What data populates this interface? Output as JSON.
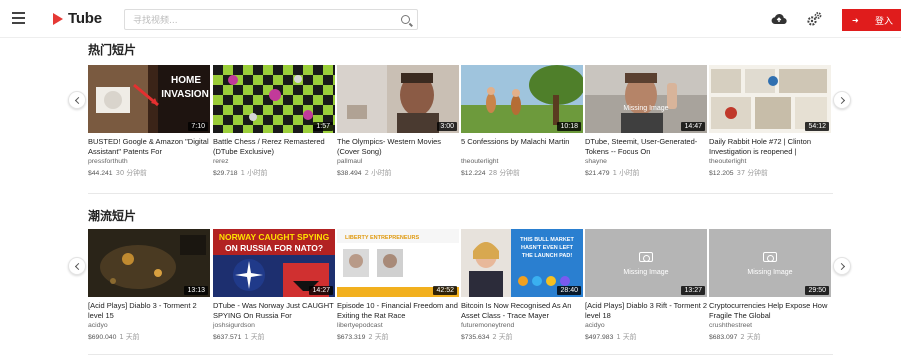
{
  "brand": {
    "name": "Tube"
  },
  "search": {
    "placeholder": "寻找视频..."
  },
  "header": {
    "login_label": "登入"
  },
  "sections": [
    {
      "title": "热门短片",
      "videos": [
        {
          "title": "BUSTED! Google & Amazon \"Digital Assistant\" Patents For",
          "author": "pressforthuth",
          "price": "$44.241",
          "time": "30 分钟前",
          "duration": "7:10"
        },
        {
          "title": "Battle Chess / Rerez Remastered (DTube Exclusive)",
          "author": "rerez",
          "price": "$29.718",
          "time": "1 小时前",
          "duration": "1:57"
        },
        {
          "title": "The Olympics- Western Movies (Cover Song)",
          "author": "pallmaul",
          "price": "$38.494",
          "time": "2 小时前",
          "duration": "3:00"
        },
        {
          "title": "5 Confessions by Malachi Martin",
          "author": "theouterlight",
          "price": "$12.224",
          "time": "28 分钟前",
          "duration": "10:18"
        },
        {
          "title": "DTube, Steemit, User-Generated-Tokens -- Focus On",
          "author": "shayne",
          "price": "$21.479",
          "time": "1 小时前",
          "duration": "14:47",
          "missing_label": "Missing Image"
        },
        {
          "title": "Daily Rabbit Hole #72 | Clinton Investigation is reopened |",
          "author": "theouterlight",
          "price": "$12.205",
          "time": "37 分钟前",
          "duration": "54:12"
        }
      ]
    },
    {
      "title": "潮流短片",
      "videos": [
        {
          "title": "[Acid Plays] Diablo 3 - Torment 2 level 15",
          "author": "acidyo",
          "price": "$690.040",
          "time": "1 天前",
          "duration": "13:13"
        },
        {
          "title": "DTube - Was Norway Just CAUGHT SPYING On Russia For",
          "author": "joshsigurdson",
          "price": "$637.571",
          "time": "1 天前",
          "duration": "14:27",
          "thumb_text": [
            "NORWAY CAUGHT SPYING",
            "ON RUSSIA FOR NATO?"
          ]
        },
        {
          "title": "Episode 10 - Financial Freedom and Exiting the Rat Race",
          "author": "libertyepodcast",
          "price": "$673.319",
          "time": "2 天前",
          "duration": "42:52",
          "thumb_text": [
            "LIBERTY ENTREPRENEURS"
          ]
        },
        {
          "title": "Bitcoin Is Now Recognised As An Asset Class - Trace Mayer",
          "author": "futuremoneytrend",
          "price": "$735.634",
          "time": "2 天前",
          "duration": "28:40",
          "thumb_text": [
            "THIS BULL MARKET",
            "HASN'T EVEN LEFT",
            "THE LAUNCH PAD!"
          ]
        },
        {
          "title": "[Acid Plays] Diablo 3 Rift - Torment 2 level 18",
          "author": "acidyo",
          "price": "$497.983",
          "time": "1 天前",
          "duration": "13:27",
          "missing_label": "Missing Image"
        },
        {
          "title": "Cryptocurrencies Help Expose How Fragile The Global",
          "author": "crushthestreet",
          "price": "$683.097",
          "time": "2 天前",
          "duration": "29:50",
          "missing_label": "Missing Image"
        }
      ]
    }
  ],
  "thumb_text_top": [
    "HOME",
    "INVASION"
  ],
  "colors": {
    "accent": "#e01c1c",
    "logo": "#e53935",
    "placeholder_gray": "#b5b5b5"
  }
}
